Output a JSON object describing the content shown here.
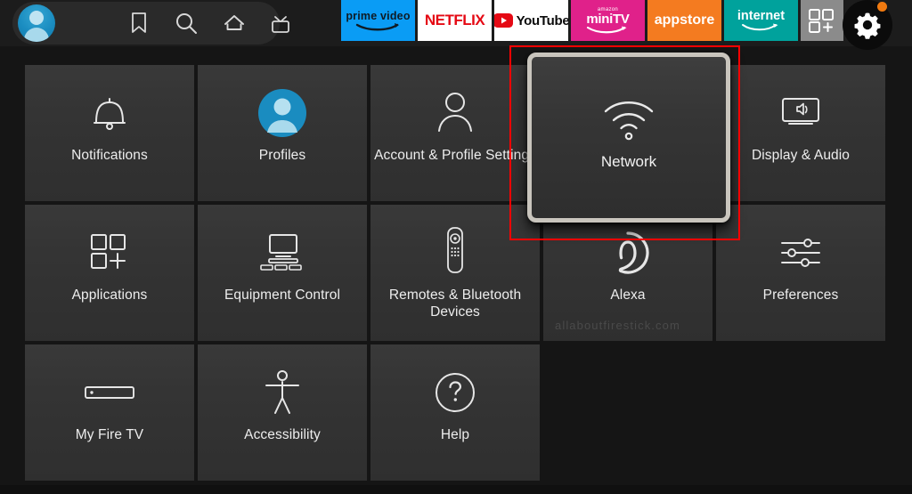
{
  "topbar": {
    "profile_label": "profile-avatar",
    "nav_icons": [
      {
        "name": "bookmark-icon",
        "label": "Watchlist"
      },
      {
        "name": "search-icon",
        "label": "Search"
      },
      {
        "name": "home-icon",
        "label": "Home"
      },
      {
        "name": "live-tv-icon",
        "label": "Live TV"
      }
    ],
    "apps": [
      {
        "name": "prime-video",
        "label": "prime video"
      },
      {
        "name": "netflix",
        "label": "NETFLIX"
      },
      {
        "name": "youtube",
        "label": "YouTube"
      },
      {
        "name": "amazon-minitv",
        "label": "miniTV",
        "sublabel": "amazon"
      },
      {
        "name": "appstore",
        "label": "appstore"
      },
      {
        "name": "internet",
        "label": "internet"
      },
      {
        "name": "app-library",
        "label": "Apps"
      },
      {
        "name": "settings-gear",
        "label": "Settings",
        "badge": true
      }
    ],
    "colors": {
      "prime": "#0a9cf5",
      "netflix_red": "#e50914",
      "minitv": "#e0218a",
      "appstore": "#f47b20",
      "internet": "#00a29c",
      "badge": "#f07a10"
    }
  },
  "settings_grid": {
    "tiles": [
      {
        "id": "notifications",
        "label": "Notifications",
        "icon": "bell-icon",
        "selected": false
      },
      {
        "id": "profiles",
        "label": "Profiles",
        "icon": "profile-avatar-icon",
        "selected": false
      },
      {
        "id": "account-profile-settings",
        "label": "Account & Profile Settings",
        "icon": "person-outline-icon",
        "selected": false
      },
      {
        "id": "network",
        "label": "Network",
        "icon": "wifi-icon",
        "selected": true
      },
      {
        "id": "display-audio",
        "label": "Display & Audio",
        "icon": "tv-speaker-icon",
        "selected": false
      },
      {
        "id": "applications",
        "label": "Applications",
        "icon": "app-squares-plus-icon",
        "selected": false
      },
      {
        "id": "equipment-control",
        "label": "Equipment Control",
        "icon": "monitor-devices-icon",
        "selected": false
      },
      {
        "id": "remotes-bluetooth-devices",
        "label": "Remotes & Bluetooth Devices",
        "icon": "remote-control-icon",
        "selected": false
      },
      {
        "id": "alexa",
        "label": "Alexa",
        "icon": "alexa-ring-icon",
        "selected": false
      },
      {
        "id": "preferences",
        "label": "Preferences",
        "icon": "sliders-icon",
        "selected": false
      },
      {
        "id": "my-fire-tv",
        "label": "My Fire TV",
        "icon": "firestick-device-icon",
        "selected": false
      },
      {
        "id": "accessibility",
        "label": "Accessibility",
        "icon": "accessibility-person-icon",
        "selected": false
      },
      {
        "id": "help",
        "label": "Help",
        "icon": "question-mark-circle-icon",
        "selected": false
      }
    ],
    "selected_tile_id": "network",
    "highlight_color": "#ff0000",
    "selected_border_color": "#c9c5bd",
    "tile_bg_color": "#333333"
  },
  "watermark": {
    "text": "allaboutfirestick.com"
  }
}
